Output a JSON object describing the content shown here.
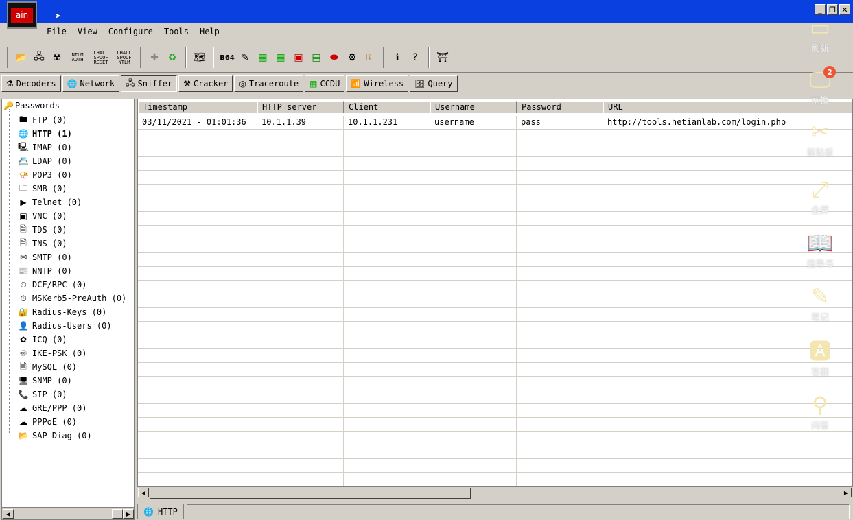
{
  "app": {
    "logo_text": "ain"
  },
  "window_buttons": {
    "minimize": "_",
    "restore": "❐",
    "close": "✕"
  },
  "menu": [
    "File",
    "View",
    "Configure",
    "Tools",
    "Help"
  ],
  "toolbar_labels": {
    "ntlm_auth": "NTLM AUTH",
    "chall_spoof_reset": "CHALL SPOOF RESET",
    "chall_spoof_ntlm": "CHALL SPOOF NTLM",
    "b64": "B64"
  },
  "tabs": [
    {
      "label": "Decoders",
      "icon": "decoder-icon"
    },
    {
      "label": "Network",
      "icon": "network-icon"
    },
    {
      "label": "Sniffer",
      "icon": "sniffer-icon"
    },
    {
      "label": "Cracker",
      "icon": "cracker-icon"
    },
    {
      "label": "Traceroute",
      "icon": "traceroute-icon"
    },
    {
      "label": "CCDU",
      "icon": "ccdu-icon"
    },
    {
      "label": "Wireless",
      "icon": "wireless-icon"
    },
    {
      "label": "Query",
      "icon": "query-icon"
    }
  ],
  "tree": {
    "root": "Passwords",
    "items": [
      "FTP (0)",
      "HTTP (1)",
      "IMAP (0)",
      "LDAP (0)",
      "POP3 (0)",
      "SMB (0)",
      "Telnet (0)",
      "VNC (0)",
      "TDS (0)",
      "TNS (0)",
      "SMTP (0)",
      "NNTP (0)",
      "DCE/RPC (0)",
      "MSKerb5-PreAuth (0)",
      "Radius-Keys (0)",
      "Radius-Users (0)",
      "ICQ (0)",
      "IKE-PSK (0)",
      "MySQL (0)",
      "SNMP (0)",
      "SIP (0)",
      "GRE/PPP (0)",
      "PPPoE (0)",
      "SAP Diag (0)"
    ]
  },
  "table": {
    "columns": [
      "Timestamp",
      "HTTP server",
      "Client",
      "Username",
      "Password",
      "URL"
    ],
    "rows": [
      [
        "03/11/2021 - 01:01:36",
        "10.1.1.39",
        "10.1.1.231",
        "username",
        "pass",
        "http://tools.hetianlab.com/login.php"
      ]
    ]
  },
  "bottom_tab": {
    "label": "HTTP"
  },
  "side_panel": {
    "badge": "2",
    "items": [
      "刷新",
      "切换",
      "剪贴板",
      "全屏",
      "指导书",
      "笔记",
      "答题",
      "问答"
    ]
  }
}
